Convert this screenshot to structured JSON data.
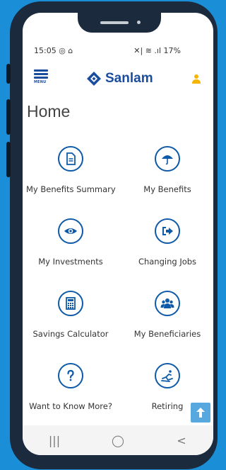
{
  "status_bar": {
    "time": "15:05",
    "left_icons": "◎ ⌂",
    "right_icons": "✕| ≋ .ıl",
    "battery": "17%"
  },
  "app_bar": {
    "menu_label": "MENU",
    "brand": "Sanlam"
  },
  "page": {
    "title": "Home"
  },
  "tiles": [
    {
      "label": "My Benefits Summary",
      "icon": "document-icon"
    },
    {
      "label": "My Benefits",
      "icon": "umbrella-icon"
    },
    {
      "label": "My Investments",
      "icon": "eye-icon"
    },
    {
      "label": "Changing Jobs",
      "icon": "exit-arrow-icon"
    },
    {
      "label": "Savings Calculator",
      "icon": "calculator-icon"
    },
    {
      "label": "My Beneficiaries",
      "icon": "people-icon"
    },
    {
      "label": "Want to Know More?",
      "icon": "question-icon"
    },
    {
      "label": "Retiring",
      "icon": "recliner-icon"
    }
  ],
  "nav": {
    "recents": "|||",
    "home": "◯",
    "back": "<"
  },
  "colors": {
    "background": "#1a8fd8",
    "brand": "#1a4d9e",
    "icon_ring": "#0e5aa8",
    "accent": "#f5b400"
  }
}
